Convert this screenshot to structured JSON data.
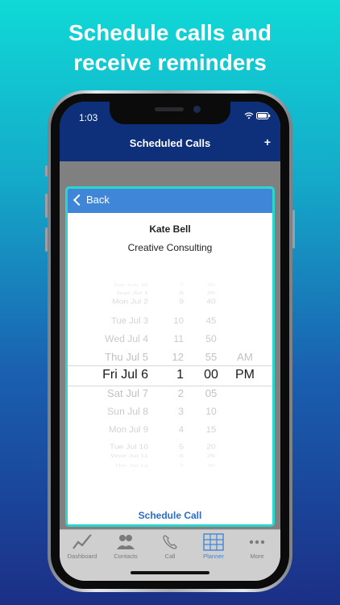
{
  "headline": [
    "Schedule calls and",
    "receive reminders"
  ],
  "status": {
    "time": "1:03",
    "icons": "◔ ▮"
  },
  "navbar": {
    "title": "Scheduled Calls",
    "add_label": "+"
  },
  "modal": {
    "back_label": "Back",
    "contact_name": "Kate Bell",
    "company": "Creative Consulting",
    "schedule_label": "Schedule Call"
  },
  "picker": {
    "rows": [
      {
        "date": "Sat Jun 30",
        "hour": "7",
        "minute": "30",
        "ampm": ""
      },
      {
        "date": "Sun Jul 1",
        "hour": "8",
        "minute": "35",
        "ampm": ""
      },
      {
        "date": "Mon Jul 2",
        "hour": "9",
        "minute": "40",
        "ampm": ""
      },
      {
        "date": "Tue Jul 3",
        "hour": "10",
        "minute": "45",
        "ampm": ""
      },
      {
        "date": "Wed Jul 4",
        "hour": "11",
        "minute": "50",
        "ampm": ""
      },
      {
        "date": "Thu Jul 5",
        "hour": "12",
        "minute": "55",
        "ampm": "AM"
      },
      {
        "date": "Fri Jul 6",
        "hour": "1",
        "minute": "00",
        "ampm": "PM"
      },
      {
        "date": "Sat Jul 7",
        "hour": "2",
        "minute": "05",
        "ampm": ""
      },
      {
        "date": "Sun Jul 8",
        "hour": "3",
        "minute": "10",
        "ampm": ""
      },
      {
        "date": "Mon Jul 9",
        "hour": "4",
        "minute": "15",
        "ampm": ""
      },
      {
        "date": "Tue Jul 10",
        "hour": "5",
        "minute": "20",
        "ampm": ""
      },
      {
        "date": "Wed Jul 11",
        "hour": "6",
        "minute": "25",
        "ampm": ""
      },
      {
        "date": "Thu Jul 12",
        "hour": "7",
        "minute": "30",
        "ampm": ""
      }
    ],
    "selected_index": 6
  },
  "tabs": [
    {
      "label": "Dashboard",
      "icon": "chart-line-icon",
      "active": false
    },
    {
      "label": "Contacts",
      "icon": "people-icon",
      "active": false
    },
    {
      "label": "Call",
      "icon": "phone-icon",
      "active": false
    },
    {
      "label": "Planner",
      "icon": "calendar-grid-icon",
      "active": true
    },
    {
      "label": "More",
      "icon": "more-dots-icon",
      "active": false
    }
  ],
  "colors": {
    "navbar": "#0e2f7a",
    "modal_header": "#3f86d9",
    "modal_border": "#2bd6cf",
    "accent": "#2a6cc7",
    "tab_active": "#3f86d9",
    "tab_inactive": "#7b7b7b"
  }
}
